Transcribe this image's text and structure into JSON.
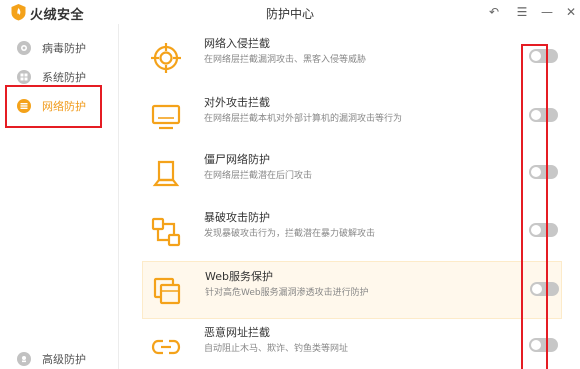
{
  "window": {
    "brand": "火绒安全",
    "title": "防护中心",
    "controls": {
      "back": "↶",
      "menu": "☰",
      "minimize": "—",
      "close": "✕"
    }
  },
  "sidebar": {
    "items": [
      {
        "label": "病毒防护",
        "icon": "virus-protection-icon",
        "active": false
      },
      {
        "label": "系统防护",
        "icon": "system-protection-icon",
        "active": false
      },
      {
        "label": "网络防护",
        "icon": "network-protection-icon",
        "active": true
      },
      {
        "label": "高级防护",
        "icon": "advanced-protection-icon",
        "active": false
      }
    ]
  },
  "protections": [
    {
      "title": "网络入侵拦截",
      "desc": "在网络层拦截漏洞攻击、黑客入侵等威胁",
      "icon": "target-icon",
      "enabled": false
    },
    {
      "title": "对外攻击拦截",
      "desc": "在网络层拦截本机对外部计算机的漏洞攻击等行为",
      "icon": "monitor-icon",
      "enabled": false
    },
    {
      "title": "僵尸网络防护",
      "desc": "在网络层拦截潜在后门攻击",
      "icon": "zombie-pc-icon",
      "enabled": false
    },
    {
      "title": "暴破攻击防护",
      "desc": "发现暴破攻击行为，拦截潜在暴力破解攻击",
      "icon": "brute-force-icon",
      "enabled": false
    },
    {
      "title": "Web服务保护",
      "desc": "针对高危Web服务漏洞渗透攻击进行防护",
      "icon": "web-service-icon",
      "enabled": false
    },
    {
      "title": "恶意网址拦截",
      "desc": "自动阻止木马、欺诈、钓鱼类等网址",
      "icon": "link-icon",
      "enabled": false
    }
  ],
  "colors": {
    "accent": "#f4a21a",
    "highlight": "#e51c23",
    "toggle_off": "#c7c7c7"
  }
}
